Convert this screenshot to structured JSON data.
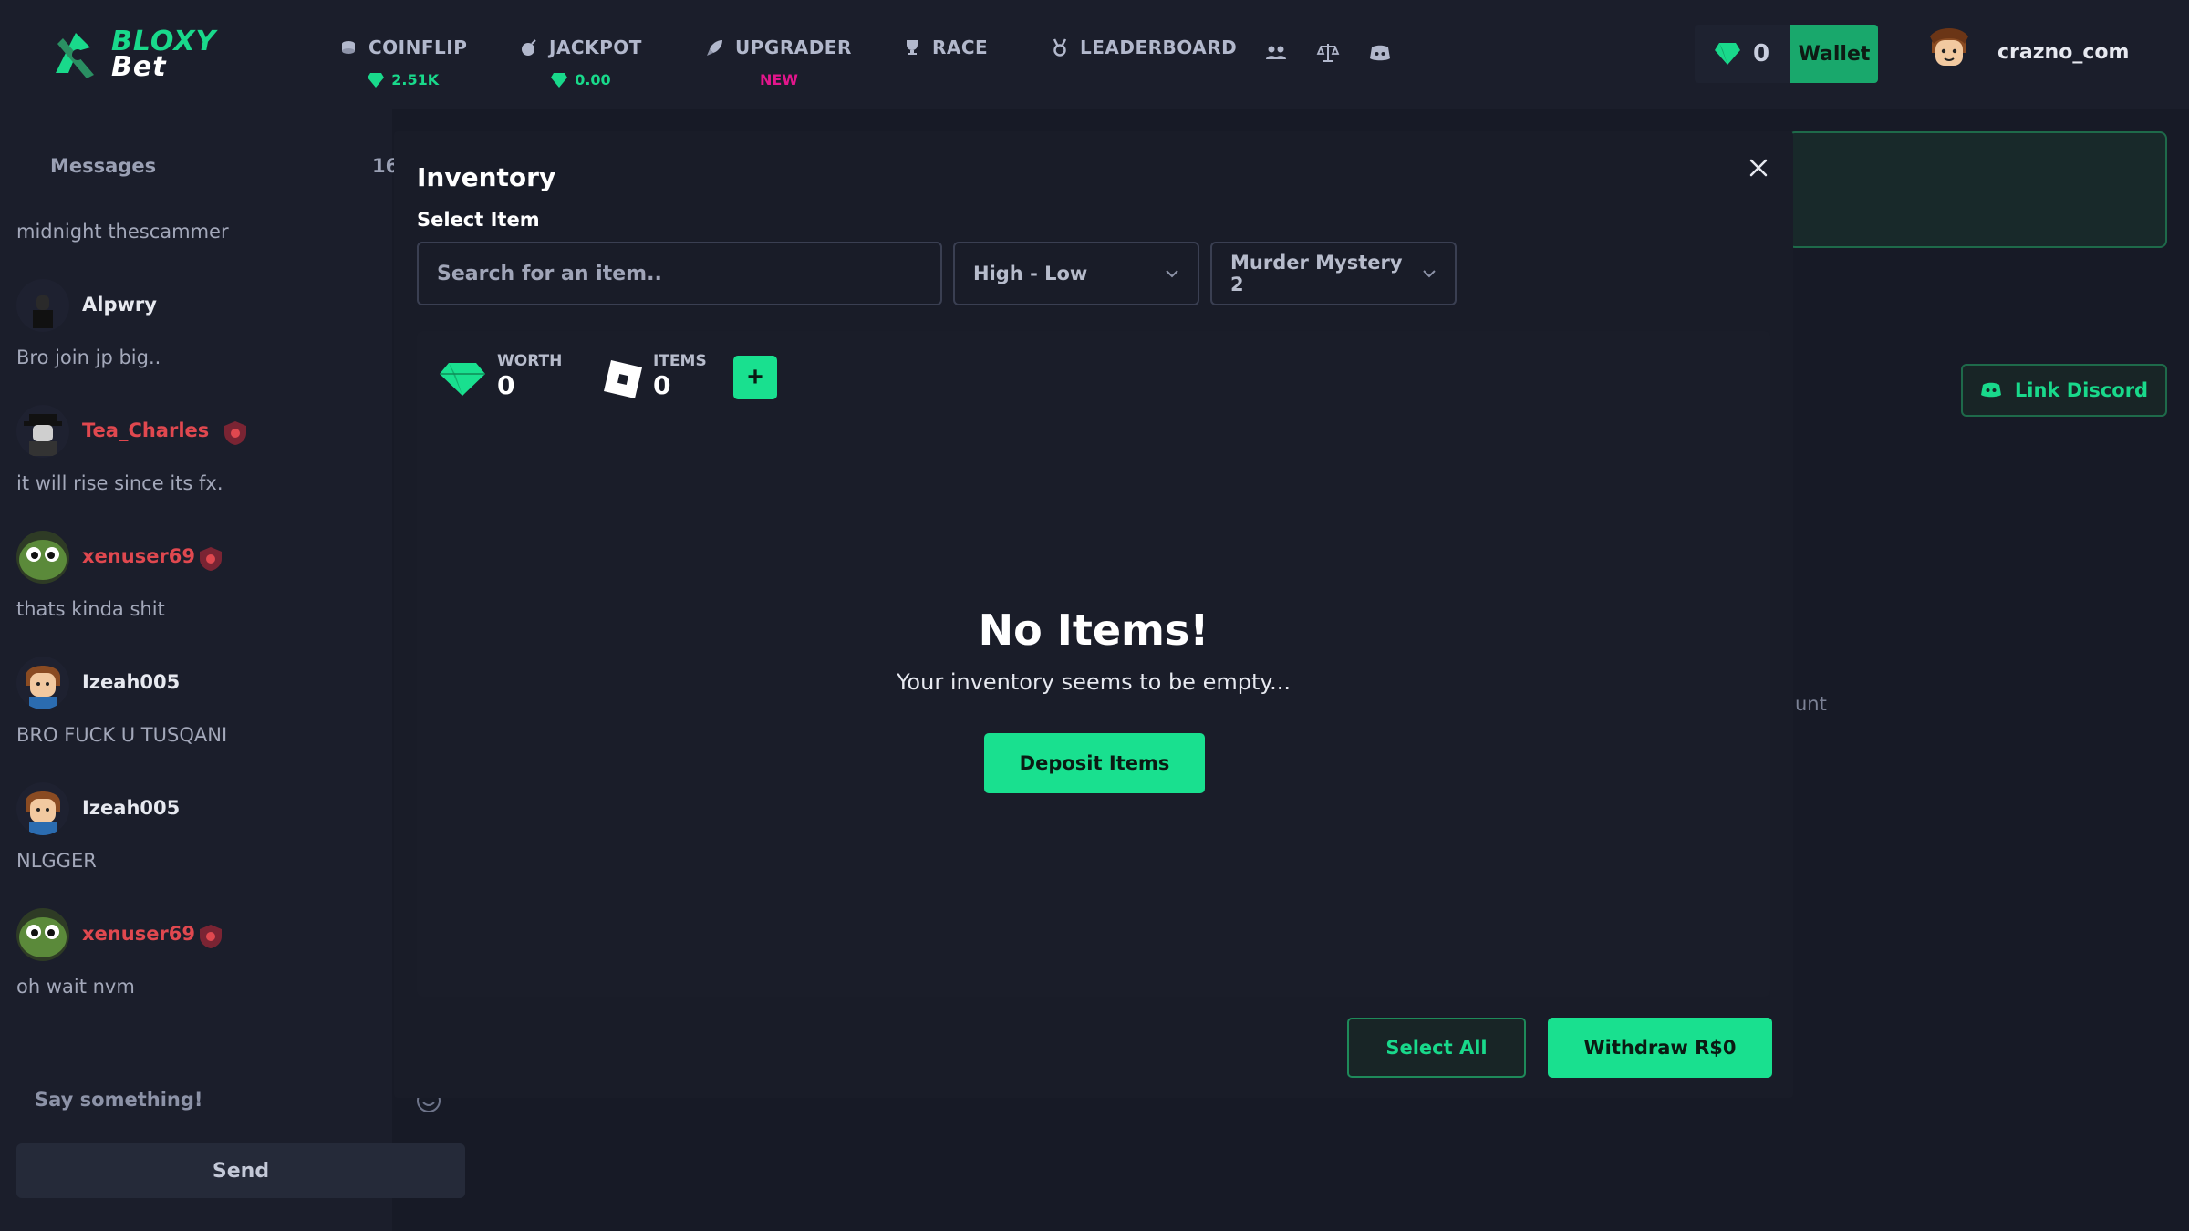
{
  "brand": {
    "line1": "BLOXY",
    "line2": "Bet",
    "accent": "#19d98b"
  },
  "nav": {
    "coinflip": {
      "label": "COINFLIP",
      "sub": "2.51K"
    },
    "jackpot": {
      "label": "JACKPOT",
      "sub": "0.00"
    },
    "upgrader": {
      "label": "UPGRADER",
      "sub": "NEW"
    },
    "race": {
      "label": "RACE"
    },
    "leaderboard": {
      "label": "LEADERBOARD"
    }
  },
  "header": {
    "balance": "0",
    "wallet_label": "Wallet",
    "username": "crazno_com"
  },
  "chat": {
    "title": "Messages",
    "count": "16",
    "top_message": "midnight thescammer",
    "messages": [
      {
        "user": "Alpwry",
        "text": "Bro join jp big.."
      },
      {
        "user": "Tea_Charles",
        "text": "it will rise since its fx."
      },
      {
        "user": "xenuser69",
        "text": "thats kinda shit"
      },
      {
        "user": "Izeah005",
        "text": "BRO FUCK U TUSQANI"
      },
      {
        "user": "Izeah005",
        "text": "NLGGER"
      },
      {
        "user": "xenuser69",
        "text": "oh wait nvm"
      }
    ],
    "input_placeholder": "Say something!",
    "send_label": "Send"
  },
  "background": {
    "link_discord_label": "Link Discord",
    "partial_text": "unt"
  },
  "modal": {
    "title": "Inventory",
    "select_label": "Select Item",
    "search_placeholder": "Search for an item..",
    "sort_value": "High - Low",
    "game_value": "Murder Mystery 2",
    "worth_label": "WORTH",
    "worth_value": "0",
    "items_label": "ITEMS",
    "items_value": "0",
    "plus_label": "+",
    "empty_title": "No Items!",
    "empty_subtitle": "Your inventory seems to be empty...",
    "deposit_label": "Deposit Items",
    "select_all_label": "Select All",
    "withdraw_label": "Withdraw R$0"
  }
}
